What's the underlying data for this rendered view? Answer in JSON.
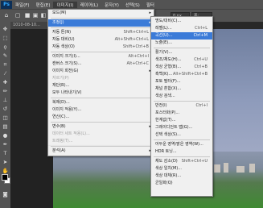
{
  "menubar": {
    "logo": "Ps",
    "items": [
      "파일(F)",
      "편집(E)",
      "이미지(I)",
      "레이어(L)",
      "문자(Y)",
      "선택(S)",
      "필터"
    ]
  },
  "options": {
    "field1": "0 px",
    "field2": "폭:"
  },
  "document": {
    "tab": "1010-08-10…"
  },
  "image_menu": {
    "items": [
      {
        "label": "모드(M)",
        "arrow": "▸"
      },
      {
        "label": "조정(J)",
        "arrow": "▸"
      },
      {
        "label": "자동 톤(N)",
        "shortcut": "Shift+Ctrl+L"
      },
      {
        "label": "자동 대비(U)",
        "shortcut": "Alt+Shift+Ctrl+L"
      },
      {
        "label": "자동 색상(O)",
        "shortcut": "Shift+Ctrl+B"
      },
      {
        "label": "이미지 크기(I)...",
        "shortcut": "Alt+Ctrl+I"
      },
      {
        "label": "캔버스 크기(S)...",
        "shortcut": "Alt+Ctrl+C"
      },
      {
        "label": "이미지 회전(G)",
        "arrow": "▸"
      },
      {
        "label": "자르기(P)"
      },
      {
        "label": "재단(R)..."
      },
      {
        "label": "모두 나타내기(V)"
      },
      {
        "label": "복제(D)..."
      },
      {
        "label": "이미지 적용(Y)..."
      },
      {
        "label": "연산(C)..."
      },
      {
        "label": "변수(B)",
        "arrow": "▸"
      },
      {
        "label": "데이터 세트 적용(L)..."
      },
      {
        "label": "트래핑(T)..."
      },
      {
        "label": "분석(A)",
        "arrow": "▸"
      }
    ]
  },
  "adjust_menu": {
    "items": [
      {
        "label": "명도/대비(C)...",
        "shortcut": ""
      },
      {
        "label": "레벨(L)...",
        "shortcut": "Ctrl+L"
      },
      {
        "label": "곡선(U)...",
        "shortcut": "Ctrl+M"
      },
      {
        "label": "노출(E)..."
      },
      {
        "label": "활기(V)..."
      },
      {
        "label": "색조/채도(H)...",
        "shortcut": "Ctrl+U"
      },
      {
        "label": "색상 균형(B)...",
        "shortcut": "Ctrl+B"
      },
      {
        "label": "흑백(K)...",
        "shortcut": "Alt+Shift+Ctrl+B"
      },
      {
        "label": "포토 필터(F)..."
      },
      {
        "label": "채널 혼합(X)..."
      },
      {
        "label": "색상 검색..."
      },
      {
        "label": "반전(I)",
        "shortcut": "Ctrl+I"
      },
      {
        "label": "포스터화(P)..."
      },
      {
        "label": "한계값(T)..."
      },
      {
        "label": "그레이디언트 맵(G)..."
      },
      {
        "label": "선택 색상(S)..."
      },
      {
        "label": "어두운 영역/밝은 영역(W)..."
      },
      {
        "label": "HDR 토닝..."
      },
      {
        "label": "채도 감소(D)",
        "shortcut": "Shift+Ctrl+U"
      },
      {
        "label": "색상 일치(M)..."
      },
      {
        "label": "색상 대체(R)..."
      },
      {
        "label": "균일화(Q)"
      }
    ]
  }
}
